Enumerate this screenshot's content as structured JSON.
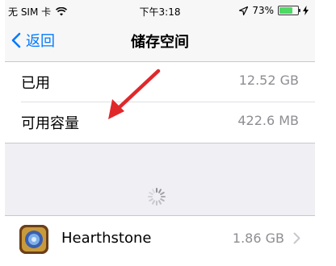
{
  "status_bar": {
    "carrier": "无 SIM 卡",
    "time": "下午3:18",
    "battery_percent": "73%",
    "battery_level": 0.73
  },
  "nav": {
    "back_label": "返回",
    "title": "储存空间"
  },
  "storage": {
    "used_label": "已用",
    "used_value": "12.52 GB",
    "available_label": "可用容量",
    "available_value": "422.6 MB"
  },
  "apps": [
    {
      "name": "Hearthstone",
      "size": "1.86 GB"
    }
  ],
  "colors": {
    "accent": "#007aff",
    "annotation_arrow": "#e0282b",
    "secondary_text": "#8e8e93"
  }
}
